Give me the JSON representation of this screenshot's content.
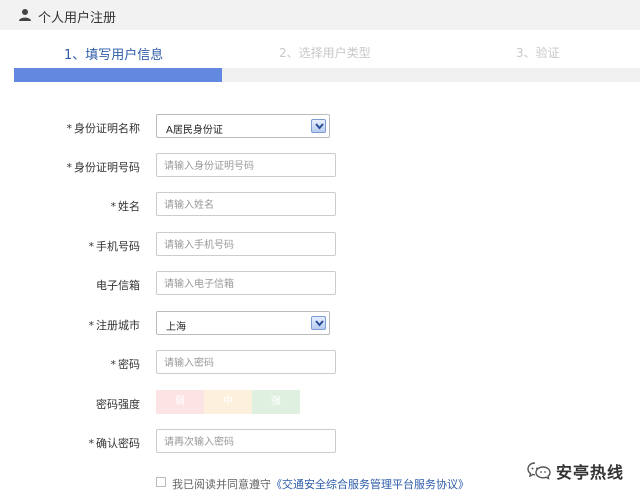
{
  "header": {
    "title": "个人用户注册",
    "icon": "user-icon"
  },
  "steps": [
    {
      "label": "1、填写用户信息",
      "active": true
    },
    {
      "label": "2、选择用户类型",
      "active": false
    },
    {
      "label": "3、验证",
      "active": false
    }
  ],
  "progress": {
    "fraction": 0.333,
    "color": "#6388e0"
  },
  "form": {
    "id_type": {
      "label": "身份证明名称",
      "required": "*",
      "value": "A居民身份证"
    },
    "id_number": {
      "label": "身份证明号码",
      "required": "*",
      "placeholder": "请输入身份证明号码"
    },
    "name": {
      "label": "姓名",
      "required": "*",
      "placeholder": "请输入姓名"
    },
    "phone": {
      "label": "手机号码",
      "required": "*",
      "placeholder": "请输入手机号码"
    },
    "email": {
      "label": "电子信箱",
      "required": "",
      "placeholder": "请输入电子信箱"
    },
    "city": {
      "label": "注册城市",
      "required": "*",
      "value": "上海"
    },
    "password": {
      "label": "密码",
      "required": "*",
      "placeholder": "请输入密码"
    },
    "strength": {
      "label": "密码强度",
      "weak": "弱",
      "medium": "中",
      "strong": "强"
    },
    "confirm": {
      "label": "确认密码",
      "required": "*",
      "placeholder": "请再次输入密码"
    }
  },
  "agreement": {
    "text": "我已阅读并同意遵守",
    "link": "《交通安全综合服务管理平台服务协议》"
  },
  "watermark": {
    "text": "安亭热线"
  }
}
